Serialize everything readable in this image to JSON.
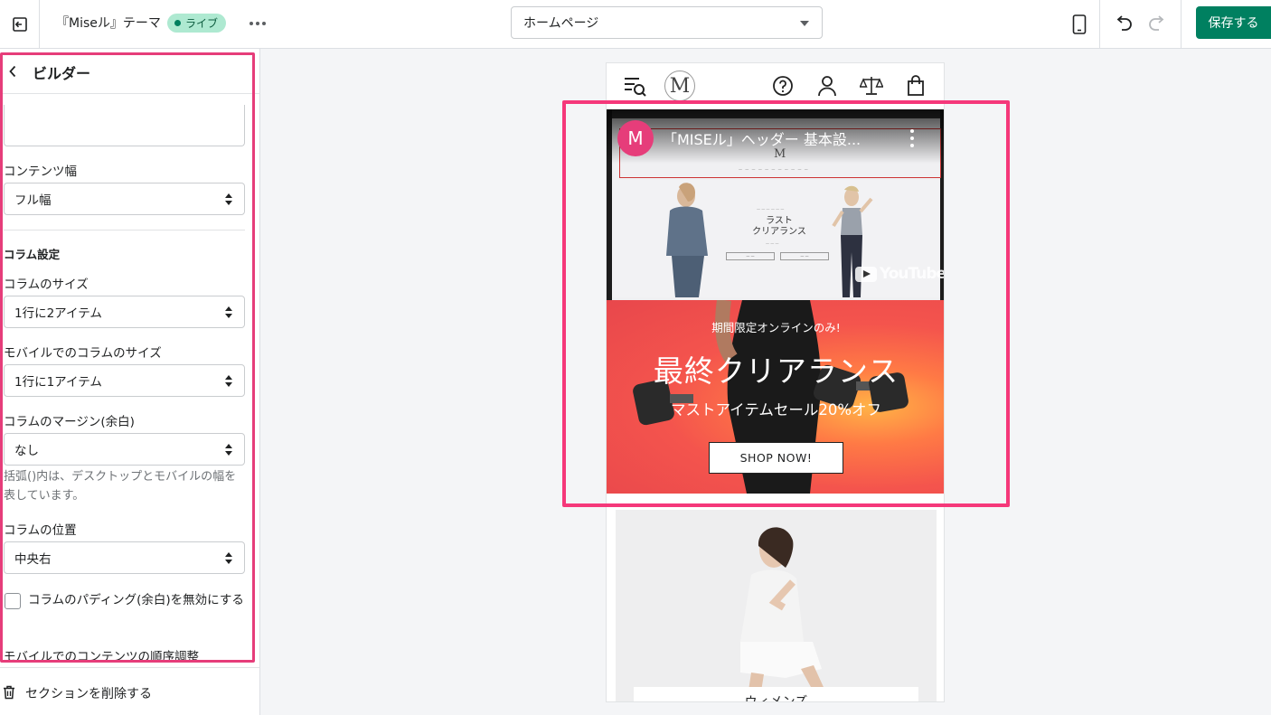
{
  "topbar": {
    "theme_name": "『Miseル』テーマ",
    "live_badge": "ライブ",
    "page_selector": "ホームページ",
    "save_label": "保存する",
    "icons": {
      "exit": "exit-icon",
      "more": "more-horizontal-icon",
      "device": "mobile-device-icon",
      "undo": "undo-icon",
      "redo": "redo-icon"
    }
  },
  "sidebar": {
    "title": "ビルダー",
    "content_width": {
      "label": "コンテンツ幅",
      "value": "フル幅"
    },
    "column_section_heading": "コラム設定",
    "column_size": {
      "label": "コラムのサイズ",
      "value": "1行に2アイテム"
    },
    "mobile_column_size": {
      "label": "モバイルでのコラムのサイズ",
      "value": "1行に1アイテム"
    },
    "column_margin": {
      "label": "コラムのマージン(余白)",
      "value": "なし"
    },
    "help_text": "括弧()内は、デスクトップとモバイルの幅を表しています。",
    "column_position": {
      "label": "コラムの位置",
      "value": "中央右"
    },
    "disable_padding_label": "コラムのパディング(余白)を無効にする",
    "mobile_order_label": "モバイルでのコンテンツの順序調整",
    "delete_section_label": "セクションを削除する"
  },
  "preview": {
    "logo_letter": "M",
    "video": {
      "channel_initial": "M",
      "title": "「MISEル」ヘッダー 基本設...",
      "mini_logo": "M",
      "mini_banner_title": "ラスト\nクリアランス",
      "youtube_text": "YouTube"
    },
    "promo": {
      "eyebrow": "期間限定オンラインのみ!",
      "title": "最終クリアランス",
      "subtitle": "マストアイテムセール20%オフ",
      "button": "SHOP NOW!"
    },
    "collection_label": "ウィメンズ"
  },
  "colors": {
    "accent_green": "#008060",
    "highlight_pink": "#f5387a",
    "live_badge_bg": "#aee9d1"
  }
}
